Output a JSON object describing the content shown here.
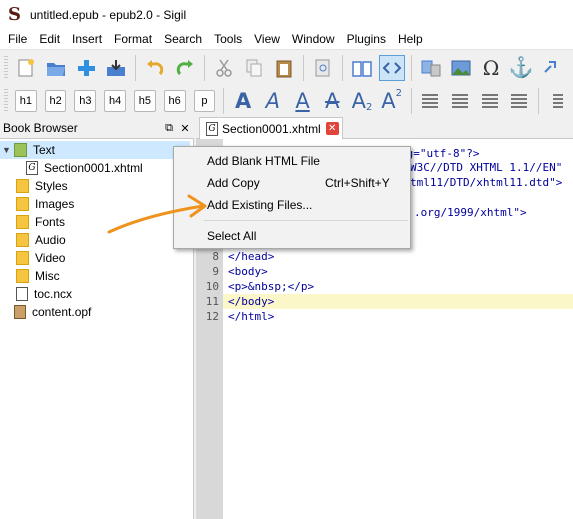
{
  "window": {
    "title": "untitled.epub - epub2.0 - Sigil",
    "logo_letter": "S"
  },
  "menubar": [
    "File",
    "Edit",
    "Insert",
    "Format",
    "Search",
    "Tools",
    "View",
    "Window",
    "Plugins",
    "Help"
  ],
  "toolbar": {
    "heading_buttons": [
      "h1",
      "h2",
      "h3",
      "h4",
      "h5",
      "h6",
      "p"
    ],
    "text_style_buttons": [
      "A",
      "A",
      "A",
      "A",
      "A",
      "A"
    ],
    "subscript": "2",
    "superscript": "2"
  },
  "book_browser": {
    "title": "Book Browser",
    "float_icon": "⧉",
    "close_icon": "✕",
    "items": [
      {
        "label": "Text",
        "type": "folder-text",
        "expanded": true
      },
      {
        "label": "Section0001.xhtml",
        "type": "file",
        "glyph": "G"
      },
      {
        "label": "Styles",
        "type": "folder"
      },
      {
        "label": "Images",
        "type": "folder"
      },
      {
        "label": "Fonts",
        "type": "folder"
      },
      {
        "label": "Audio",
        "type": "folder"
      },
      {
        "label": "Video",
        "type": "folder"
      },
      {
        "label": "Misc",
        "type": "folder"
      },
      {
        "label": "toc.ncx",
        "type": "file"
      },
      {
        "label": "content.opf",
        "type": "file"
      }
    ]
  },
  "editor": {
    "tab_label": "Section0001.xhtml",
    "tab_close": "✕",
    "partial_lines": [
      "ng=\"utf-8\"?>",
      "W3C//DTD XHTML 1.1//EN\"",
      "tml11/DTD/xhtml11.dtd\">",
      ".org/1999/xhtml\">"
    ],
    "line_numbers": [
      "8",
      "9",
      "10",
      "11",
      "12"
    ],
    "lines": [
      "</head>",
      "<body>",
      "<p>&nbsp;</p>",
      "</body>",
      "</html>"
    ]
  },
  "context_menu": {
    "items": [
      {
        "label": "Add Blank HTML File",
        "shortcut": ""
      },
      {
        "label": "Add Copy",
        "shortcut": "Ctrl+Shift+Y"
      },
      {
        "label": "Add Existing Files...",
        "shortcut": ""
      },
      {
        "label": "Select All",
        "shortcut": ""
      }
    ]
  },
  "colors": {
    "accent_arrow": "#f0931c",
    "brand": "#5a1b14",
    "selection": "#cde8ff",
    "highlight_line": "#fbf7c9"
  }
}
